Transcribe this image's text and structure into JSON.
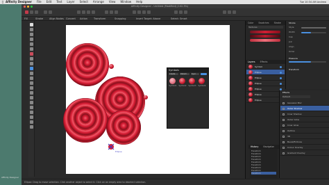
{
  "menubar": {
    "apple": "",
    "items": [
      "Affinity Designer",
      "File",
      "Edit",
      "Text",
      "Layer",
      "Select",
      "Arrange",
      "View",
      "Window",
      "Help"
    ],
    "right": "Tue 10:34 AM  Andrew"
  },
  "window": {
    "title": "Affinity Designer - Untitled (Modified) (102.3%)",
    "side_label": "Affinity Designer"
  },
  "context_toolbar": {
    "items": [
      "Fill",
      "Stroke",
      "Align Nodes",
      "Convert",
      "Action",
      "Transform",
      "Snapping",
      "Insert Target: Above",
      "Select: Smart"
    ]
  },
  "symbols_panel": {
    "title": "Symbols",
    "chips": [
      "Create",
      "Detach",
      "Sync"
    ],
    "symbols": [
      {
        "label": "Symbol1"
      },
      {
        "label": "Symbol2"
      },
      {
        "label": "Symbol3"
      },
      {
        "label": "Symbol4"
      }
    ]
  },
  "status": {
    "text": "Ellipse: Drag to move selection. Click another object to select it. Click on an empty area to deselect selection."
  },
  "selection": {
    "label": "Ellipse"
  },
  "right_panel": {
    "tabs_top": [
      "Color",
      "Swatches",
      "Stroke",
      "Brushes"
    ],
    "top_active": 3,
    "brushes_category": "Textures",
    "tabs_mid": [
      "Layers",
      "Effects",
      "Styles",
      "Text Styles"
    ],
    "mid_active": 0,
    "layers": [
      {
        "name": "Symbol",
        "selected": false
      },
      {
        "name": "Ellipse",
        "selected": true
      },
      {
        "name": "Ellipse",
        "selected": false
      },
      {
        "name": "Ellipse",
        "selected": false
      },
      {
        "name": "Ellipse",
        "selected": false
      },
      {
        "name": "Ellipse",
        "selected": false
      },
      {
        "name": "Ellipse",
        "selected": false
      }
    ],
    "stroke": {
      "title": "Stroke",
      "rows": [
        "Style",
        "Width",
        "Cap",
        "Join",
        "Align",
        "Order"
      ]
    },
    "pressure": "Pressure",
    "transform": "Transform",
    "history": {
      "tabs": [
        "History",
        "Navigator",
        "Transform"
      ],
      "rows": [
        "Transform",
        "Transform",
        "Transform",
        "Transform",
        "Transform",
        "Transform",
        "Transform",
        "Transform",
        "Transform"
      ]
    },
    "effects": {
      "title": "Effects",
      "preset": "Default",
      "rows": [
        "Gaussian Blur",
        "Outer Shadow",
        "Inner Shadow",
        "Outer Glow",
        "Inner Glow",
        "Outline",
        "3D",
        "Bevel/Emboss",
        "Colour Overlay",
        "Gradient Overlay"
      ]
    }
  }
}
